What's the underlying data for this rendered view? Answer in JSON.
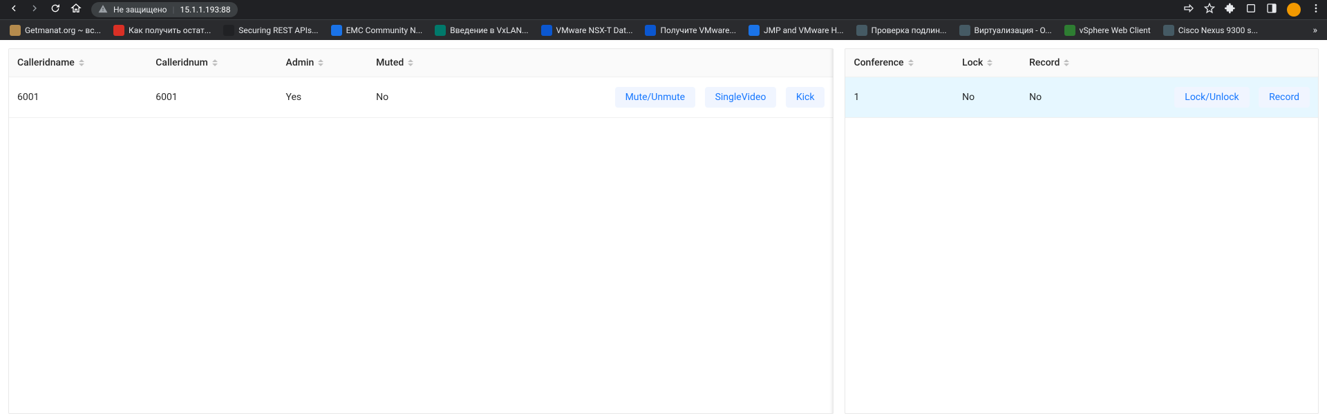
{
  "browser": {
    "security_label": "Не защищено",
    "url": "15.1.1.193:88",
    "bookmarks": [
      {
        "label": "Getmanat.org ~ вс...",
        "color": "#b58b4d"
      },
      {
        "label": "Как получить остат...",
        "color": "#d93025"
      },
      {
        "label": "Securing REST APIs...",
        "color": "#202124"
      },
      {
        "label": "EMC Community N...",
        "color": "#1a73e8"
      },
      {
        "label": "Введение в VxLAN...",
        "color": "#00796b"
      },
      {
        "label": "VMware NSX-T Dat...",
        "color": "#0b57d0"
      },
      {
        "label": "Получите VMware...",
        "color": "#0b57d0"
      },
      {
        "label": "JMP and VMware H...",
        "color": "#1a73e8"
      },
      {
        "label": "Проверка подлин...",
        "color": "#455a64"
      },
      {
        "label": "Виртуализация - O...",
        "color": "#455a64"
      },
      {
        "label": "vSphere Web Client",
        "color": "#2e7d32"
      },
      {
        "label": "Cisco Nexus 9300 s...",
        "color": "#455a64"
      }
    ]
  },
  "participants": {
    "columns": [
      "Calleridname",
      "Calleridnum",
      "Admin",
      "Muted"
    ],
    "rows": [
      {
        "calleridname": "6001",
        "calleridnum": "6001",
        "admin": "Yes",
        "muted": "No"
      }
    ],
    "actions": {
      "mute": "Mute/Unmute",
      "single_video": "SingleVideo",
      "kick": "Kick"
    }
  },
  "conferences": {
    "columns": [
      "Conference",
      "Lock",
      "Record"
    ],
    "rows": [
      {
        "conference": "1",
        "lock": "No",
        "record": "No"
      }
    ],
    "actions": {
      "lock": "Lock/Unlock",
      "record": "Record"
    }
  }
}
